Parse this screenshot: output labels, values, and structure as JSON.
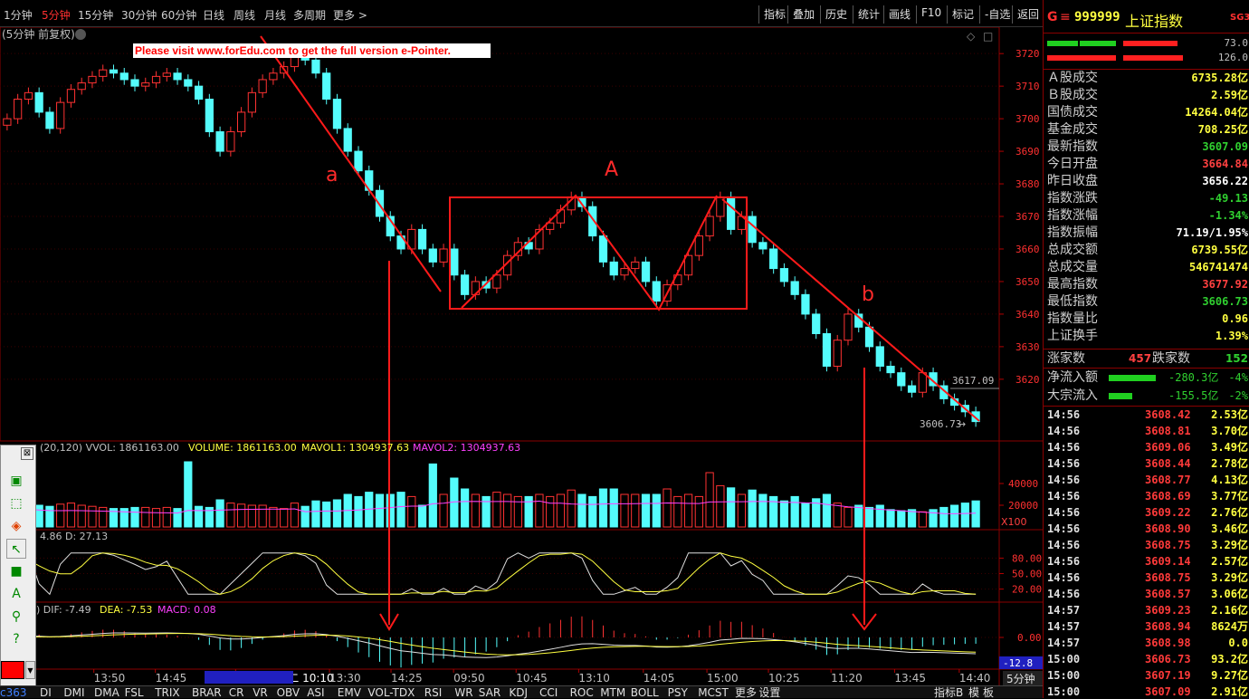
{
  "toolbar": {
    "periods": [
      "1分钟",
      "5分钟",
      "15分钟",
      "30分钟",
      "60分钟",
      "日线",
      "周线",
      "月线",
      "多周期",
      "更多 >"
    ],
    "active_period": 1,
    "tools": [
      "指标",
      "叠加",
      "历史",
      "统计",
      "画线",
      "F10",
      "标记",
      "-自选",
      "返回"
    ]
  },
  "main_title": "(5分钟 前复权)",
  "watermark": "Please visit www.forEdu.com to get the full version e-Pointer.",
  "annotations": {
    "a": "a",
    "A": "A",
    "b": "b"
  },
  "price_labels": {
    "last": "3617.09",
    "low": "3606.73"
  },
  "vol_header": {
    "prefix": "(20,120) VVOL: 1861163.00",
    "volume": "VOLUME: 1861163.00",
    "mavol1": "MAVOL1: 1304937.63",
    "mavol2": "MAVOL2: 1304937.63",
    "unit": "X100"
  },
  "kdj_header": "4.86  D: 27.13",
  "macd_header": {
    "dif": ") DIF: -7.49",
    "dea": "DEA: -7.53",
    "macd": "MACD: 0.08",
    "side_value": "-12.8"
  },
  "time_axis": [
    {
      "label": "5",
      "x": 0.5
    },
    {
      "label": "13:50",
      "x": 0.09
    },
    {
      "label": "14:45",
      "x": 0.149
    },
    {
      "label": "21/09/14/二 10:10",
      "x": 0.226
    },
    {
      "label": "13:30",
      "x": 0.316
    },
    {
      "label": "14:25",
      "x": 0.375
    },
    {
      "label": "09:50",
      "x": 0.435
    },
    {
      "label": "10:45",
      "x": 0.495
    },
    {
      "label": "13:10",
      "x": 0.555
    },
    {
      "label": "14:05",
      "x": 0.617
    },
    {
      "label": "15:00",
      "x": 0.678
    },
    {
      "label": "10:25",
      "x": 0.737
    },
    {
      "label": "11:20",
      "x": 0.797
    },
    {
      "label": "13:45",
      "x": 0.858
    },
    {
      "label": "14:40",
      "x": 0.92
    }
  ],
  "period_badge": "5分钟",
  "bottom_tabs": [
    "DI",
    "DMI",
    "DMA",
    "FSL",
    "TRIX",
    "BRAR",
    "CR",
    "VR",
    "OBV",
    "ASI",
    "EMV",
    "VOL-TDX",
    "RSI",
    "WR",
    "SAR",
    "KDJ",
    "CCI",
    "ROC",
    "MTM",
    "BOLL",
    "PSY",
    "MCST",
    "更多",
    "设置"
  ],
  "bottom_right": [
    "指标B",
    "模",
    "板"
  ],
  "corner_label": "c363",
  "right_panel": {
    "logo": "G",
    "code": "999999",
    "name": "上证指数",
    "badge": "SG3",
    "bar_values": [
      "73.0",
      "126.0"
    ],
    "rows": [
      {
        "label": "Ａ股成交",
        "value": "6735.28亿",
        "color": "#ffff40"
      },
      {
        "label": "Ｂ股成交",
        "value": "2.59亿",
        "color": "#ffff40"
      },
      {
        "label": "国债成交",
        "value": "14264.04亿",
        "color": "#ffff40"
      },
      {
        "label": "基金成交",
        "value": "708.25亿",
        "color": "#ffff40"
      },
      {
        "label": "最新指数",
        "value": "3607.09",
        "color": "#30d030"
      },
      {
        "label": "今日开盘",
        "value": "3664.84",
        "color": "#ff4040"
      },
      {
        "label": "昨日收盘",
        "value": "3656.22",
        "color": "#ffffff"
      },
      {
        "label": "指数涨跌",
        "value": "-49.13",
        "color": "#30d030"
      },
      {
        "label": "指数涨幅",
        "value": "-1.34%",
        "color": "#30d030"
      },
      {
        "label": "指数振幅",
        "value": "71.19/1.95%",
        "color": "#ffffff"
      },
      {
        "label": "总成交额",
        "value": "6739.55亿",
        "color": "#ffff40"
      },
      {
        "label": "总成交量",
        "value": "546741474",
        "color": "#ffff40"
      },
      {
        "label": "最高指数",
        "value": "3677.92",
        "color": "#ff4040"
      },
      {
        "label": "最低指数",
        "value": "3606.73",
        "color": "#30d030"
      },
      {
        "label": "指数量比",
        "value": "0.96",
        "color": "#ffff40"
      },
      {
        "label": "上证换手",
        "value": "1.39%",
        "color": "#ffff40"
      }
    ],
    "advance_label": "涨家数",
    "advance_value": "457",
    "decline_label": "跌家数",
    "decline_value": "152",
    "flows": [
      {
        "label": "净流入额",
        "value": "-280.3亿",
        "pct": "-4%"
      },
      {
        "label": "大宗流入",
        "value": "-155.5亿",
        "pct": "-2%"
      }
    ],
    "ticks": [
      {
        "time": "14:56",
        "price": "3608.42",
        "vol": "2.53亿"
      },
      {
        "time": "14:56",
        "price": "3608.81",
        "vol": "3.70亿"
      },
      {
        "time": "14:56",
        "price": "3609.06",
        "vol": "3.49亿"
      },
      {
        "time": "14:56",
        "price": "3608.44",
        "vol": "2.78亿"
      },
      {
        "time": "14:56",
        "price": "3608.77",
        "vol": "4.13亿"
      },
      {
        "time": "14:56",
        "price": "3608.69",
        "vol": "3.77亿"
      },
      {
        "time": "14:56",
        "price": "3609.22",
        "vol": "2.76亿"
      },
      {
        "time": "14:56",
        "price": "3608.90",
        "vol": "3.46亿"
      },
      {
        "time": "14:56",
        "price": "3608.75",
        "vol": "3.29亿"
      },
      {
        "time": "14:56",
        "price": "3609.14",
        "vol": "2.57亿"
      },
      {
        "time": "14:56",
        "price": "3608.75",
        "vol": "3.29亿"
      },
      {
        "time": "14:56",
        "price": "3608.57",
        "vol": "3.06亿"
      },
      {
        "time": "14:57",
        "price": "3609.23",
        "vol": "2.16亿"
      },
      {
        "time": "14:57",
        "price": "3608.94",
        "vol": "8624万"
      },
      {
        "time": "14:57",
        "price": "3608.98",
        "vol": "0.0"
      },
      {
        "time": "15:00",
        "price": "3606.73",
        "vol": "93.2亿"
      },
      {
        "time": "15:00",
        "price": "3607.19",
        "vol": "9.27亿"
      },
      {
        "time": "15:00",
        "price": "3607.09",
        "vol": "2.91亿"
      }
    ]
  },
  "chart_data": [
    {
      "type": "candlestick",
      "title": "(5分钟 前复权)",
      "ylim": [
        3603,
        3727
      ],
      "yticks": [
        3620,
        3630,
        3640,
        3650,
        3660,
        3670,
        3680,
        3690,
        3700,
        3710,
        3720
      ],
      "close": [
        3700,
        3706,
        3708,
        3702,
        3697,
        3705,
        3709,
        3711,
        3713,
        3715,
        3714,
        3712,
        3710,
        3711,
        3713,
        3714,
        3712,
        3710,
        3706,
        3696,
        3690,
        3696,
        3702,
        3708,
        3712,
        3714,
        3716,
        3720,
        3718,
        3714,
        3706,
        3697,
        3690,
        3684,
        3678,
        3670,
        3664,
        3660,
        3666,
        3660,
        3656,
        3660,
        3652,
        3646,
        3650,
        3648,
        3652,
        3658,
        3662,
        3660,
        3666,
        3668,
        3672,
        3676,
        3673,
        3664,
        3656,
        3652,
        3654,
        3656,
        3650,
        3644,
        3649,
        3652,
        3658,
        3664,
        3670,
        3676,
        3666,
        3670,
        3662,
        3660,
        3654,
        3650,
        3646,
        3640,
        3634,
        3624,
        3632,
        3640,
        3636,
        3630,
        3624,
        3622,
        3618,
        3616,
        3622,
        3618,
        3614,
        3612,
        3610,
        3607
      ],
      "volume": [
        22000,
        24000,
        23000,
        20000,
        19000,
        21000,
        22000,
        20000,
        19000,
        18000,
        17000,
        17000,
        18000,
        18000,
        17000,
        18000,
        17000,
        60000,
        19000,
        18000,
        25000,
        22000,
        21000,
        20000,
        20000,
        18000,
        17000,
        22000,
        19000,
        24000,
        23000,
        25000,
        30000,
        28000,
        32000,
        30000,
        30000,
        32000,
        28000,
        20000,
        58000,
        30000,
        45000,
        35000,
        30000,
        28000,
        32000,
        30000,
        28000,
        28000,
        30000,
        28000,
        30000,
        34000,
        30000,
        28000,
        35000,
        35000,
        30000,
        30000,
        30000,
        30000,
        35000,
        28000,
        30000,
        28000,
        50000,
        38000,
        36000,
        30000,
        34000,
        30000,
        28000,
        24000,
        28000,
        22000,
        26000,
        30000,
        22000,
        18000,
        20000,
        18000,
        20000,
        16000,
        15000,
        16000,
        14000,
        16000,
        18000,
        20000,
        22000,
        24000
      ],
      "vol_yticks": [
        20000,
        40000
      ],
      "kdj_yticks": [
        20.0,
        50.0,
        80.0
      ],
      "macd_yticks": [
        0.0
      ]
    }
  ],
  "colors": {
    "up": "#ff3232",
    "down": "#54fcfc",
    "axis": "#b00000",
    "text_red": "#ff3030"
  }
}
